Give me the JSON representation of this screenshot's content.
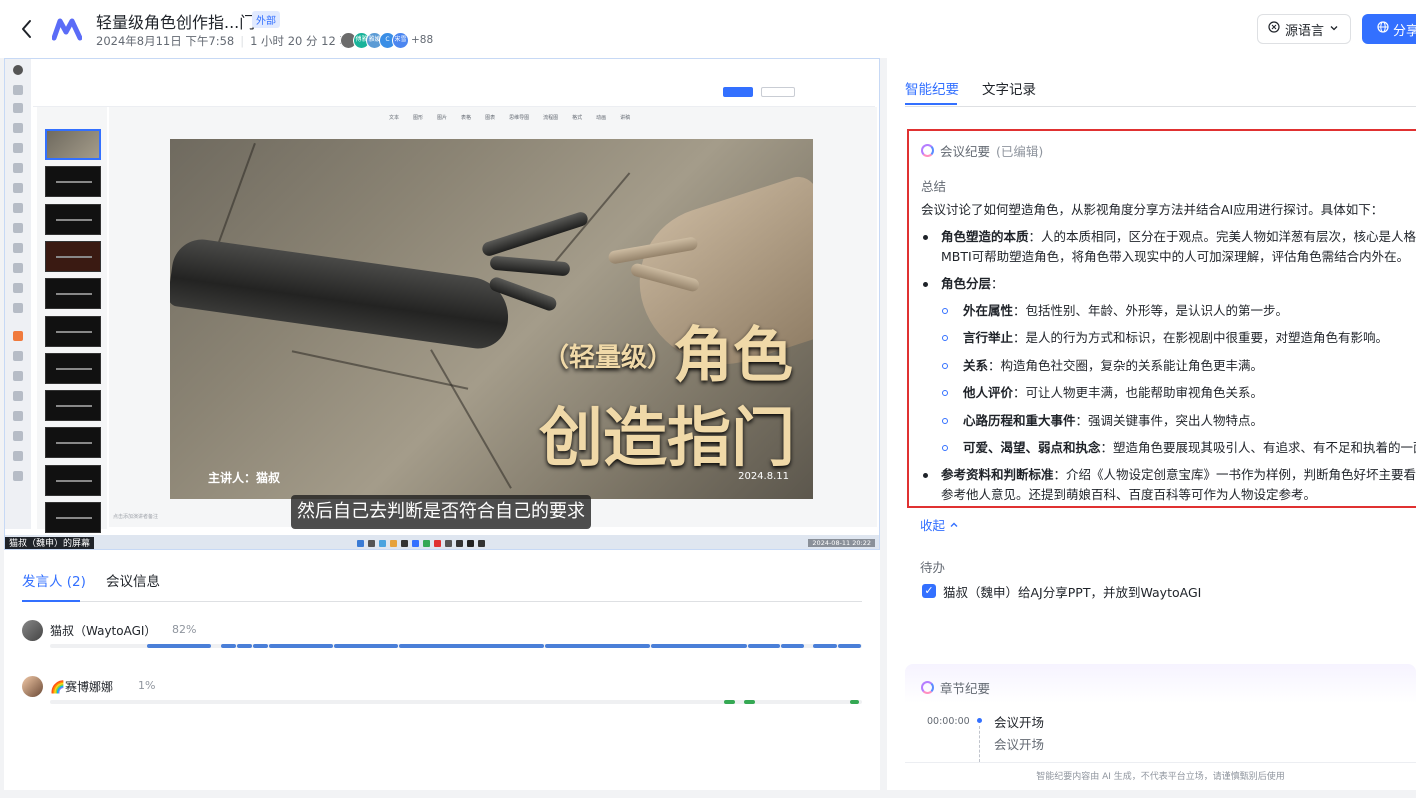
{
  "header": {
    "title": "轻量级角色创作指...门",
    "tag": "外部",
    "date": "2024年8月11日 下午7:58",
    "duration": "1 小时 20 分 12 秒",
    "participants_more": "+88",
    "avatar_colors": [
      "#6b6b6b",
      "#19b39a",
      "#5b9bd5",
      "#3a8ee6",
      "#4c86f0"
    ],
    "avatar_initials": [
      "",
      "傅雅",
      "雅媛",
      "C",
      "宋雪"
    ],
    "lang_button": "源语言",
    "share_button": "分享"
  },
  "screen": {
    "slide_title_small": "（轻量级）",
    "slide_title_big": "角色",
    "slide_title_line2": "创造指门",
    "slide_speaker": "主讲人：猫叔",
    "slide_date": "2024.8.11",
    "subtitle": "然后自己去判断是否符合自己的要求",
    "screen_label": "猫叔（魏申）的屏幕",
    "taskbar_time": "2024-08-11 20:22",
    "notes_placeholder": "点击添加演讲者备注",
    "ribbon": [
      "文本",
      "图形",
      "图片",
      "表格",
      "图表",
      "思维导图",
      "流程图",
      "格式",
      "动画",
      "讲稿"
    ],
    "progress": 0.3
  },
  "left_tabs": {
    "speakers": "发言人 (2)",
    "meeting_info": "会议信息"
  },
  "speakers": [
    {
      "name": "猫叔（WaytoAGI）",
      "pct": "82%",
      "color": "#4a7fd8",
      "segments": [
        [
          0.12,
          0.2
        ],
        [
          0.21,
          0.23
        ],
        [
          0.23,
          0.25
        ],
        [
          0.25,
          0.27
        ],
        [
          0.27,
          0.35
        ],
        [
          0.35,
          0.43
        ],
        [
          0.43,
          0.61
        ],
        [
          0.61,
          0.74
        ],
        [
          0.74,
          0.86
        ],
        [
          0.86,
          0.9
        ],
        [
          0.9,
          0.93
        ],
        [
          0.94,
          0.97
        ],
        [
          0.97,
          1.0
        ]
      ]
    },
    {
      "name": "🌈赛博娜娜",
      "pct": "1%",
      "color": "#34a853",
      "segments": [
        [
          0.83,
          0.845
        ],
        [
          0.855,
          0.87
        ],
        [
          0.985,
          0.998
        ]
      ]
    }
  ],
  "right_tabs": {
    "smart_minutes": "智能纪要",
    "transcript": "文字记录"
  },
  "summary": {
    "heading": "会议纪要",
    "edited": "(已编辑)",
    "section_label": "总结",
    "intro": "会议讨论了如何塑造角色，从影视角度分享方法并结合AI应用进行探讨。具体如下：",
    "p1_bold": "角色塑造的本质",
    "p1_text": "：人的本质相同，区分在于观点。完美人物如洋葱有层次，核心是人格",
    "p1_line2": "MBTI可帮助塑造角色，将角色带入现实中的人可加深理解，评估角色需结合内外在。",
    "p2_bold": "角色分层",
    "p2_text": "：",
    "subs": [
      {
        "bold": "外在属性",
        "text": "：包括性别、年龄、外形等，是认识人的第一步。"
      },
      {
        "bold": "言行举止",
        "text": "：是人的行为方式和标识，在影视剧中很重要，对塑造角色有影响。"
      },
      {
        "bold": "关系",
        "text": "：构造角色社交圈，复杂的关系能让角色更丰满。"
      },
      {
        "bold": "他人评价",
        "text": "：可让人物更丰满，也能帮助审视角色关系。"
      },
      {
        "bold": "心路历程和重大事件",
        "text": "：强调关键事件，突出人物特点。"
      },
      {
        "bold": "可爱、渴望、弱点和执念",
        "text": "：塑造角色要展现其吸引人、有追求、有不足和执着的一面"
      }
    ],
    "p3_bold": "参考资料和判断标准",
    "p3_text": "：介绍《人物设定创意宝库》一书作为样例，判断角色好坏主要看",
    "p3_line2": "参考他人意见。还提到萌娘百科、百度百科等可作为人物设定参考。"
  },
  "collapse": "收起",
  "todo": {
    "label": "待办",
    "item": "猫叔（魏申）给AJ分享PPT，并放到WaytoAGI",
    "checked": true
  },
  "chapters": {
    "heading": "章节纪要",
    "time": "00:00:00",
    "title": "会议开场",
    "sub": "会议开场"
  },
  "footer": "智能纪要内容由 AI 生成，不代表平台立场，请谨慎甄别后使用"
}
